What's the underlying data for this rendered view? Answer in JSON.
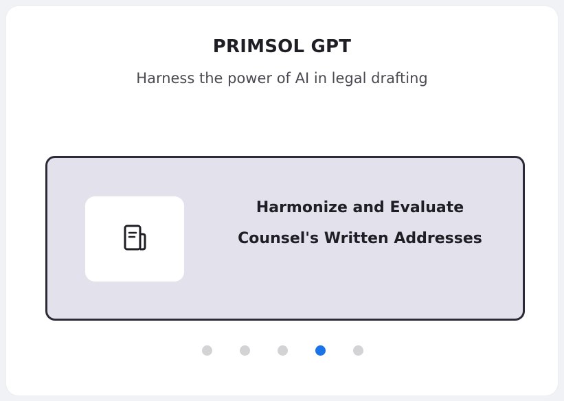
{
  "header": {
    "title": "PRIMSOL GPT",
    "subtitle": "Harness the power of AI in legal drafting"
  },
  "carousel": {
    "current_slide": {
      "icon": "document-icon",
      "title": "Harmonize and Evaluate Counsel's Written Addresses"
    },
    "slide_count": 5,
    "active_index": 3
  },
  "colors": {
    "slide_background": "#e3e1ec",
    "slide_border": "#2a2b36",
    "dot_active": "#1a73e8",
    "dot_inactive": "#d3d3d6"
  }
}
